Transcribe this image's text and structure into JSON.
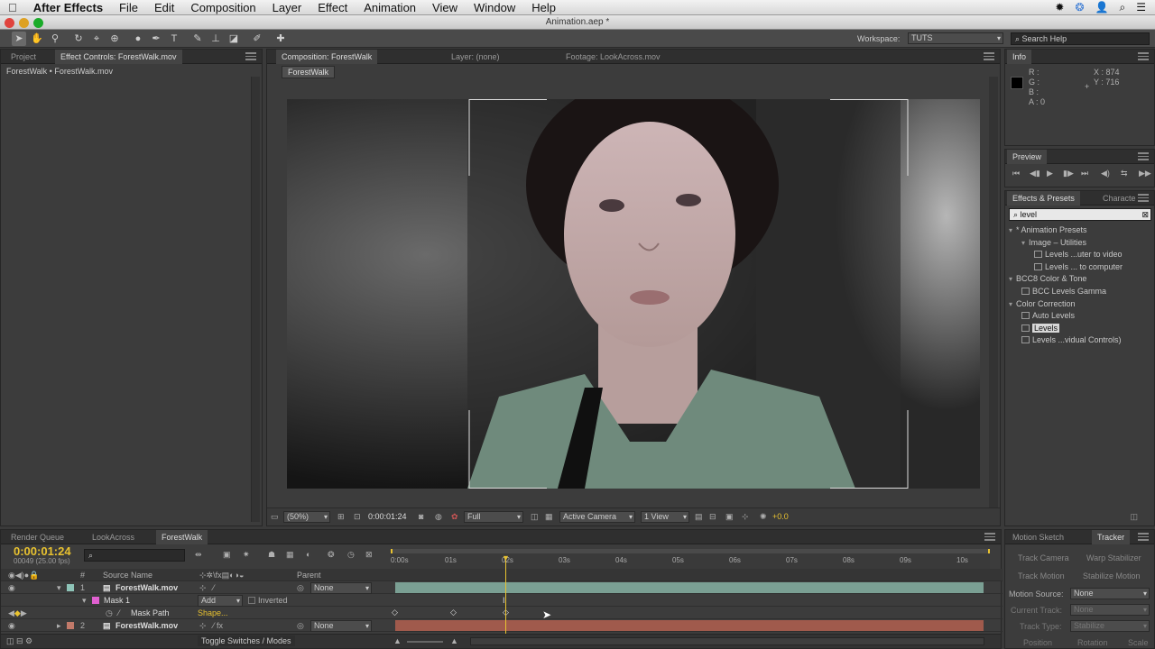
{
  "menubar": {
    "app": "After Effects",
    "items": [
      "File",
      "Edit",
      "Composition",
      "Layer",
      "Effect",
      "Animation",
      "View",
      "Window",
      "Help"
    ]
  },
  "window": {
    "title": "Animation.aep *"
  },
  "toolbar": {
    "workspace_label": "Workspace:",
    "workspace_value": "TUTS",
    "search_placeholder": "Search Help"
  },
  "project_panel": {
    "tab_project": "Project",
    "tab_effect_controls": "Effect Controls: ForestWalk.mov",
    "breadcrumb": "ForestWalk • ForestWalk.mov"
  },
  "comp_panel": {
    "tab_comp": "Composition: ForestWalk",
    "tab_layer": "Layer: (none)",
    "tab_footage": "Footage: LookAcross.mov",
    "comp_button": "ForestWalk",
    "zoom": "(50%)",
    "timecode": "0:00:01:24",
    "resolution": "Full",
    "camera": "Active Camera",
    "views": "1 View",
    "exposure": "+0.0"
  },
  "info_panel": {
    "tab": "Info",
    "r": "R :",
    "g": "G :",
    "b": "B :",
    "a": "A : 0",
    "x": "X : 874",
    "y": "Y : 716"
  },
  "preview_panel": {
    "tab": "Preview"
  },
  "effects_panel": {
    "tab": "Effects & Presets",
    "tab2": "Characte",
    "search_value": "level",
    "tree": [
      {
        "label": "* Animation Presets",
        "level": 0,
        "kind": "folder"
      },
      {
        "label": "Image – Utilities",
        "level": 1,
        "kind": "folder"
      },
      {
        "label": "Levels ...uter to video",
        "level": 2,
        "kind": "preset"
      },
      {
        "label": "Levels ... to computer",
        "level": 2,
        "kind": "preset"
      },
      {
        "label": "BCC8 Color & Tone",
        "level": 0,
        "kind": "folder"
      },
      {
        "label": "BCC Levels Gamma",
        "level": 1,
        "kind": "effect"
      },
      {
        "label": "Color Correction",
        "level": 0,
        "kind": "folder"
      },
      {
        "label": "Auto Levels",
        "level": 1,
        "kind": "effect"
      },
      {
        "label": "Levels",
        "level": 1,
        "kind": "effect",
        "selected": true
      },
      {
        "label": "Levels ...vidual Controls)",
        "level": 1,
        "kind": "effect"
      }
    ]
  },
  "tracker_panel": {
    "tab1": "Motion Sketch",
    "tab2": "Tracker",
    "track_camera": "Track Camera",
    "warp_stabilizer": "Warp Stabilizer",
    "track_motion": "Track Motion",
    "stabilize_motion": "Stabilize Motion",
    "motion_source_label": "Motion Source:",
    "motion_source_value": "None",
    "current_track_label": "Current Track:",
    "current_track_value": "None",
    "track_type_label": "Track Type:",
    "track_type_value": "Stabilize",
    "position": "Position",
    "rotation": "Rotation",
    "scale": "Scale"
  },
  "timeline": {
    "tabs": [
      "Render Queue",
      "LookAcross",
      "ForestWalk"
    ],
    "timecode": "0:00:01:24",
    "frames": "00049 (25.00 fps)",
    "col_source": "Source Name",
    "col_parent": "Parent",
    "ruler": [
      "0:00s",
      "01s",
      "02s",
      "03s",
      "04s",
      "05s",
      "06s",
      "07s",
      "08s",
      "09s",
      "10s"
    ],
    "layers": [
      {
        "num": "1",
        "name": "ForestWalk.mov",
        "parent": "None"
      },
      {
        "num": "2",
        "name": "ForestWalk.mov",
        "parent": "None"
      }
    ],
    "mask_name": "Mask 1",
    "mask_mode": "Add",
    "mask_inverted": "Inverted",
    "mask_path": "Mask Path",
    "mask_shape": "Shape...",
    "toggle_label": "Toggle Switches / Modes"
  },
  "colors": {
    "accent": "#e8c230",
    "layer1_bar": "#7a9f93",
    "layer2_bar": "#a05a4c"
  }
}
